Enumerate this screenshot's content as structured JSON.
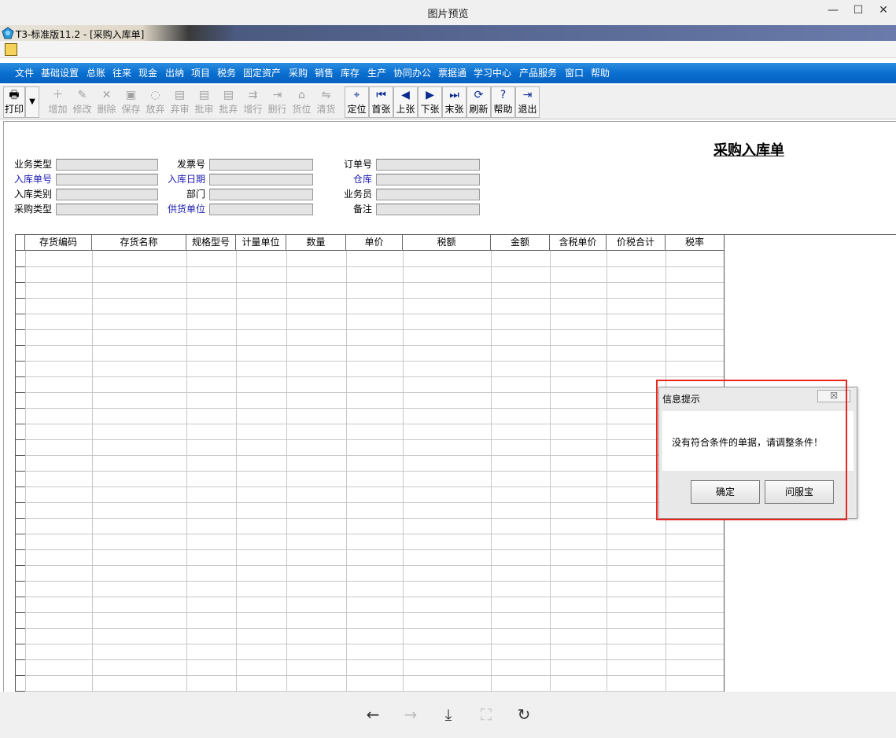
{
  "viewer": {
    "title": "图片预览",
    "window_controls": [
      "—",
      "☐",
      "✕"
    ],
    "bottom_controls": [
      {
        "name": "prev",
        "glyph": "←",
        "enabled": true
      },
      {
        "name": "next",
        "glyph": "→",
        "enabled": false
      },
      {
        "name": "download",
        "glyph": "⤓",
        "enabled": true
      },
      {
        "name": "fit",
        "glyph": "⛶",
        "enabled": false
      },
      {
        "name": "rotate",
        "glyph": "↻",
        "enabled": true
      }
    ]
  },
  "app": {
    "title": "T3-标准版11.2 - [采购入库单]",
    "menu": [
      "文件",
      "基础设置",
      "总账",
      "往来",
      "现金",
      "出纳",
      "项目",
      "税务",
      "固定资产",
      "采购",
      "销售",
      "库存",
      "生产",
      "协同办公",
      "票据通",
      "学习中心",
      "产品服务",
      "窗口",
      "帮助"
    ]
  },
  "toolbar": {
    "print": {
      "label": "打印",
      "glyph": "🖶"
    },
    "buttons": [
      {
        "label": "增加",
        "glyph": "＋",
        "enabled": false
      },
      {
        "label": "修改",
        "glyph": "✎",
        "enabled": false
      },
      {
        "label": "删除",
        "glyph": "✕",
        "enabled": false
      },
      {
        "label": "保存",
        "glyph": "▣",
        "enabled": false
      },
      {
        "label": "放弃",
        "glyph": "◌",
        "enabled": false
      },
      {
        "label": "弃审",
        "glyph": "▤",
        "enabled": false
      },
      {
        "label": "批审",
        "glyph": "▤",
        "enabled": false
      },
      {
        "label": "批弃",
        "glyph": "▤",
        "enabled": false
      },
      {
        "label": "增行",
        "glyph": "⇉",
        "enabled": false
      },
      {
        "label": "删行",
        "glyph": "⇥",
        "enabled": false
      },
      {
        "label": "货位",
        "glyph": "⌂",
        "enabled": false
      },
      {
        "label": "清货",
        "glyph": "⇋",
        "enabled": false
      },
      {
        "label": "定位",
        "glyph": "⌖",
        "enabled": true
      },
      {
        "label": "首张",
        "glyph": "⏮",
        "enabled": true
      },
      {
        "label": "上张",
        "glyph": "◀",
        "enabled": true
      },
      {
        "label": "下张",
        "glyph": "▶",
        "enabled": true
      },
      {
        "label": "末张",
        "glyph": "⏭",
        "enabled": true
      },
      {
        "label": "刷新",
        "glyph": "⟳",
        "enabled": true
      },
      {
        "label": "帮助",
        "glyph": "?",
        "enabled": true
      },
      {
        "label": "退出",
        "glyph": "⇥",
        "enabled": true
      }
    ]
  },
  "form": {
    "doc_title": "采购入库单",
    "col1": [
      {
        "label": "业务类型",
        "blue": false,
        "value": ""
      },
      {
        "label": "入库单号",
        "blue": true,
        "value": ""
      },
      {
        "label": "入库类别",
        "blue": false,
        "value": ""
      },
      {
        "label": "采购类型",
        "blue": false,
        "value": ""
      }
    ],
    "col2": [
      {
        "label": "发票号",
        "blue": false,
        "value": ""
      },
      {
        "label": "入库日期",
        "blue": true,
        "value": ""
      },
      {
        "label": "部门",
        "blue": false,
        "value": ""
      },
      {
        "label": "供货单位",
        "blue": true,
        "value": ""
      }
    ],
    "col3": [
      {
        "label": "订单号",
        "blue": false,
        "value": ""
      },
      {
        "label": "仓库",
        "blue": true,
        "value": ""
      },
      {
        "label": "业务员",
        "blue": false,
        "value": ""
      },
      {
        "label": "备注",
        "blue": false,
        "value": ""
      }
    ]
  },
  "grid": {
    "columns": [
      "存货编码",
      "存货名称",
      "规格型号",
      "计量单位",
      "数量",
      "单价",
      "税额",
      "金额",
      "含税单价",
      "价税合计",
      "税率"
    ],
    "rows": []
  },
  "dialog": {
    "title": "信息提示",
    "close_glyph": "☒",
    "message": "没有符合条件的单据，请调整条件！",
    "ok_label": "确定",
    "help_label": "问服宝"
  }
}
